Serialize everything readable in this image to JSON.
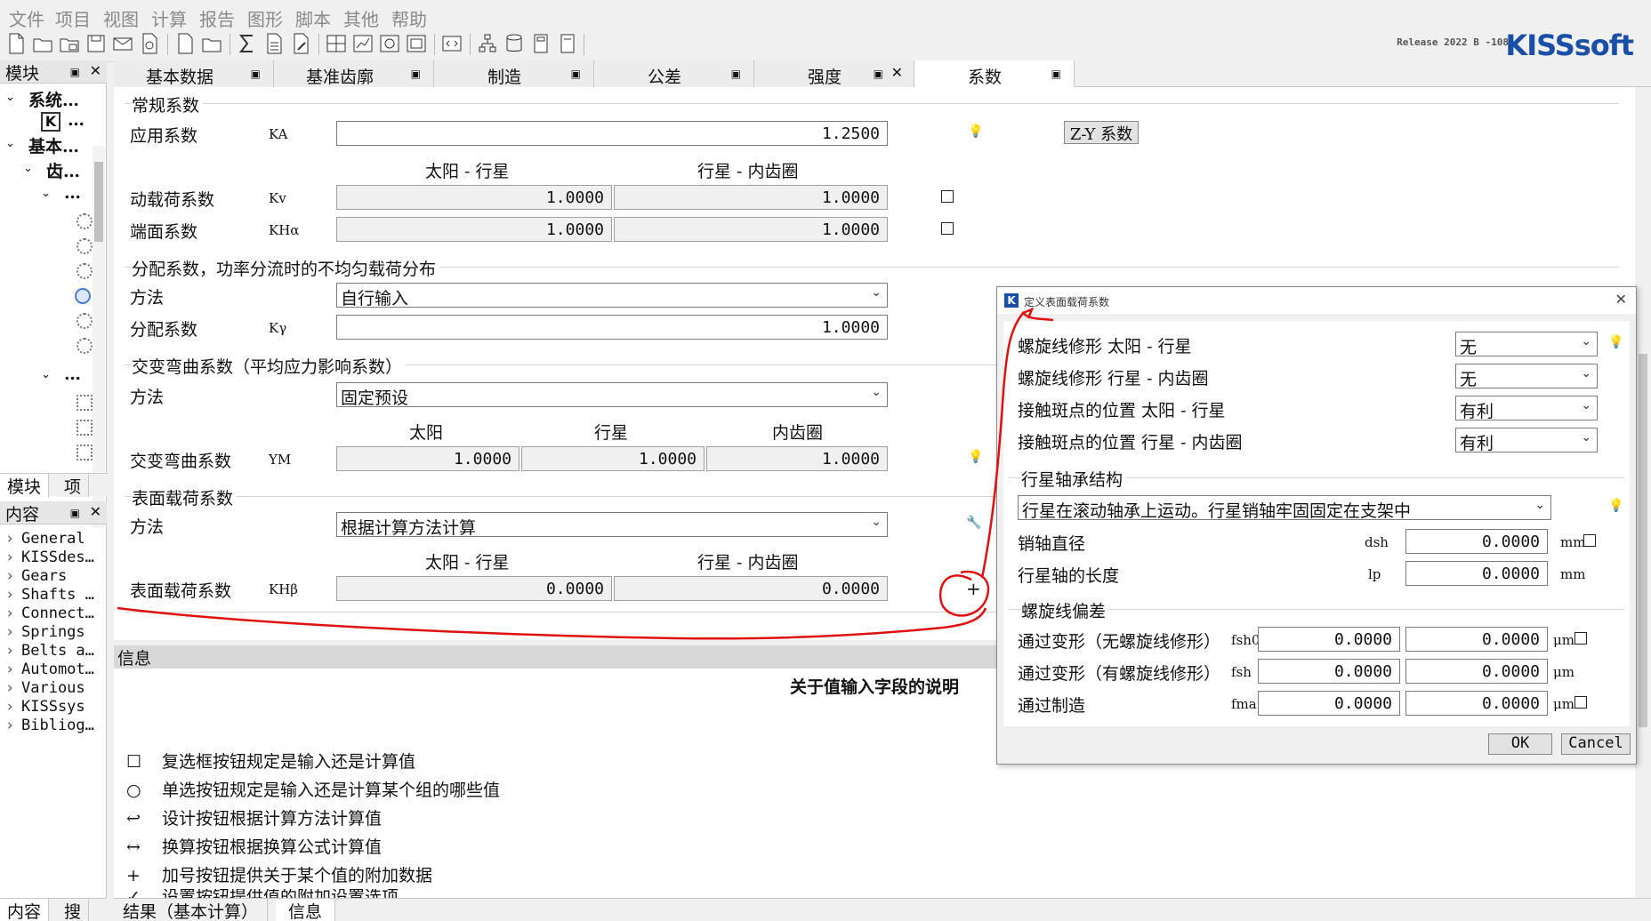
{
  "menu": [
    "文件",
    "项目",
    "视图",
    "计算",
    "报告",
    "图形",
    "脚本",
    "其他",
    "帮助"
  ],
  "release": "Release 2022 B -108",
  "logo": "KISSsoft",
  "left_panel": {
    "header": "模块",
    "tree": [
      "系统…",
      "基本…",
      "齿…",
      "…",
      "…"
    ],
    "tabs": [
      "模块",
      "项"
    ],
    "content_header": "内容",
    "content_items": [
      "General",
      "KISSdes…",
      "Gears",
      "Shafts …",
      "Connect…",
      "Springs",
      "Belts a…",
      "Automot…",
      "Various",
      "KISSsys",
      "Bibliog…"
    ],
    "bottom_tabs": [
      "内容",
      "搜"
    ]
  },
  "tabs": [
    {
      "label": "基本数据"
    },
    {
      "label": "基准齿廓"
    },
    {
      "label": "制造"
    },
    {
      "label": "公差"
    },
    {
      "label": "强度"
    },
    {
      "label": "系数"
    }
  ],
  "general": {
    "title": "常规系数",
    "app_label": "应用系数",
    "app_sym": "KA",
    "app_value": "1.2500",
    "zy_button": "Z-Y 系数",
    "col1": "太阳 - 行星",
    "col2": "行星 - 内齿圈",
    "kv_label": "动载荷系数",
    "kv_sym": "Kv",
    "kv_v1": "1.0000",
    "kv_v2": "1.0000",
    "kha_label": "端面系数",
    "kha_sym": "KHα",
    "kha_v1": "1.0000",
    "kha_v2": "1.0000"
  },
  "distribution": {
    "title": "分配系数，功率分流时的不均匀载荷分布",
    "method_label": "方法",
    "method_value": "自行输入",
    "k_label": "分配系数",
    "k_sym": "Kγ",
    "k_value": "1.0000"
  },
  "bending": {
    "title": "交变弯曲系数（平均应力影响系数）",
    "method_label": "方法",
    "method_value": "固定预设",
    "col1": "太阳",
    "col2": "行星",
    "col3": "内齿圈",
    "y_label": "交变弯曲系数",
    "y_sym": "YM",
    "v1": "1.0000",
    "v2": "1.0000",
    "v3": "1.0000"
  },
  "surface": {
    "title": "表面载荷系数",
    "method_label": "方法",
    "method_value": "根据计算方法计算",
    "col1": "太阳 - 行星",
    "col2": "行星 - 内齿圈",
    "k_label": "表面载荷系数",
    "k_sym": "KHβ",
    "v1": "0.0000",
    "v2": "0.0000",
    "plus": "+"
  },
  "info": {
    "header": "信息",
    "heading": "关于值输入字段的说明",
    "rows": [
      {
        "icon": "☐",
        "text": "复选框按钮规定是输入还是计算值"
      },
      {
        "icon": "○",
        "text": "单选按钮规定是输入还是计算某个组的哪些值"
      },
      {
        "icon": "↩",
        "text": "设计按钮根据计算方法计算值"
      },
      {
        "icon": "↔",
        "text": "换算按钮根据换算公式计算值"
      },
      {
        "icon": "+",
        "text": "加号按钮提供关于某个值的附加数据"
      }
    ],
    "cut_row": "设置按钮提供值的附加设置选项"
  },
  "bottom_tabs": [
    "结果（基本计算）",
    "信息"
  ],
  "dialog": {
    "title": "定义表面载荷系数",
    "rows": [
      {
        "label": "螺旋线修形 太阳 - 行星",
        "value": "无"
      },
      {
        "label": "螺旋线修形 行星 - 内齿圈",
        "value": "无"
      },
      {
        "label": "接触斑点的位置 太阳 - 行星",
        "value": "有利"
      },
      {
        "label": "接触斑点的位置 行星 - 内齿圈",
        "value": "有利"
      }
    ],
    "bearing": {
      "title": "行星轴承结构",
      "value": "行星在滚动轴承上运动。行星销轴牢固固定在支架中",
      "pin_label": "销轴直径",
      "pin_sym": "dsh",
      "pin_value": "0.0000",
      "pin_unit": "mm",
      "len_label": "行星轴的长度",
      "len_sym": "lp",
      "len_value": "0.0000",
      "len_unit": "mm"
    },
    "deviation": {
      "title": "螺旋线偏差",
      "r1_label": "通过变形（无螺旋线修形）",
      "r1_sym": "fsh0",
      "r1_v1": "0.0000",
      "r1_v2": "0.0000",
      "r2_label": "通过变形（有螺旋线修形）",
      "r2_sym": "fsh",
      "r2_v1": "0.0000",
      "r2_v2": "0.0000",
      "r3_label": "通过制造",
      "r3_sym": "fma",
      "r3_v1": "0.0000",
      "r3_v2": "0.0000",
      "unit": "μm"
    },
    "ok": "OK",
    "cancel": "Cancel"
  },
  "colors": {
    "brand": "#1a4fa8",
    "annotation": "#e01010"
  }
}
